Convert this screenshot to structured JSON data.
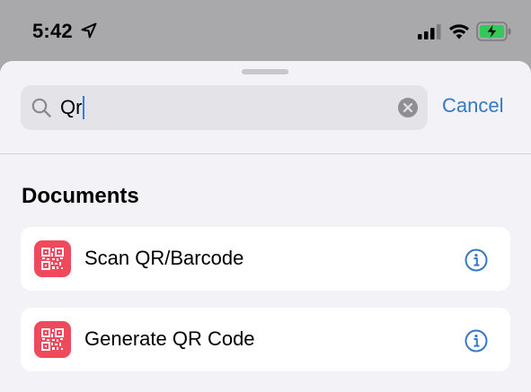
{
  "status_bar": {
    "time": "5:42",
    "location_icon": "location-arrow-icon",
    "signal_icon": "cellular-signal-icon",
    "wifi_icon": "wifi-icon",
    "battery_icon": "battery-charging-icon",
    "battery_color": "#34c759"
  },
  "search": {
    "value": "Qr",
    "icon": "search-icon",
    "clear_icon": "clear-icon",
    "cancel_label": "Cancel"
  },
  "section": {
    "title": "Documents"
  },
  "actions": [
    {
      "label": "Scan QR/Barcode",
      "icon": "qr-code-icon",
      "info_icon": "info-icon"
    },
    {
      "label": "Generate QR Code",
      "icon": "qr-code-icon",
      "info_icon": "info-icon"
    }
  ],
  "colors": {
    "accent": "#3478c6",
    "action_icon_bg": "#ef4a5c",
    "sheet_bg": "#f2f2f7",
    "dimmed_bg": "#a9a9ab"
  }
}
